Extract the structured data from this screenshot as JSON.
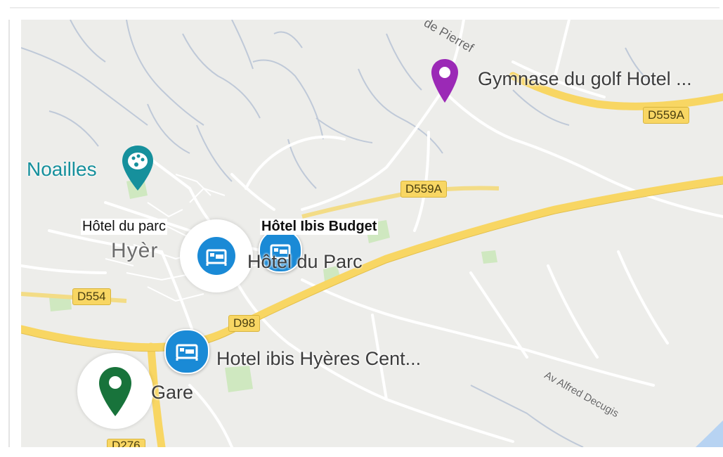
{
  "map": {
    "overlay_labels": {
      "hotel_du_parc_left": "Hôtel du parc",
      "hotel_ibis_budget": "Hôtel Ibis Budget"
    },
    "place_labels": {
      "gymnase": "Gymnase du golf Hotel ...",
      "noailles": "Noailles",
      "hyeres_partial": "Hyèr",
      "hotel_du_parc": "Hôtel du Parc",
      "hotel_ibis_centre": "Hotel ibis Hyères Cent...",
      "gare_partial": "Gare"
    },
    "road_labels": {
      "d559a_top": "D559A",
      "d559a_mid": "D559A",
      "d554": "D554",
      "d98": "D98",
      "d276": "D276",
      "street_pierrefeu": "de Pierref",
      "street_alfred": "Av Alfred Decugis"
    },
    "colors": {
      "land": "#ededea",
      "water": "#b7d3f2",
      "park": "#cfe8c0",
      "major_road": "#f8d663",
      "minor_road": "#ffffff",
      "hotel_marker": "#1a8ad6",
      "gym_marker": "#9b29b6",
      "gare_marker": "#18733b",
      "museum_marker": "#16909c"
    },
    "icons": [
      "bed-icon",
      "map-pin-icon",
      "palette-icon"
    ]
  }
}
